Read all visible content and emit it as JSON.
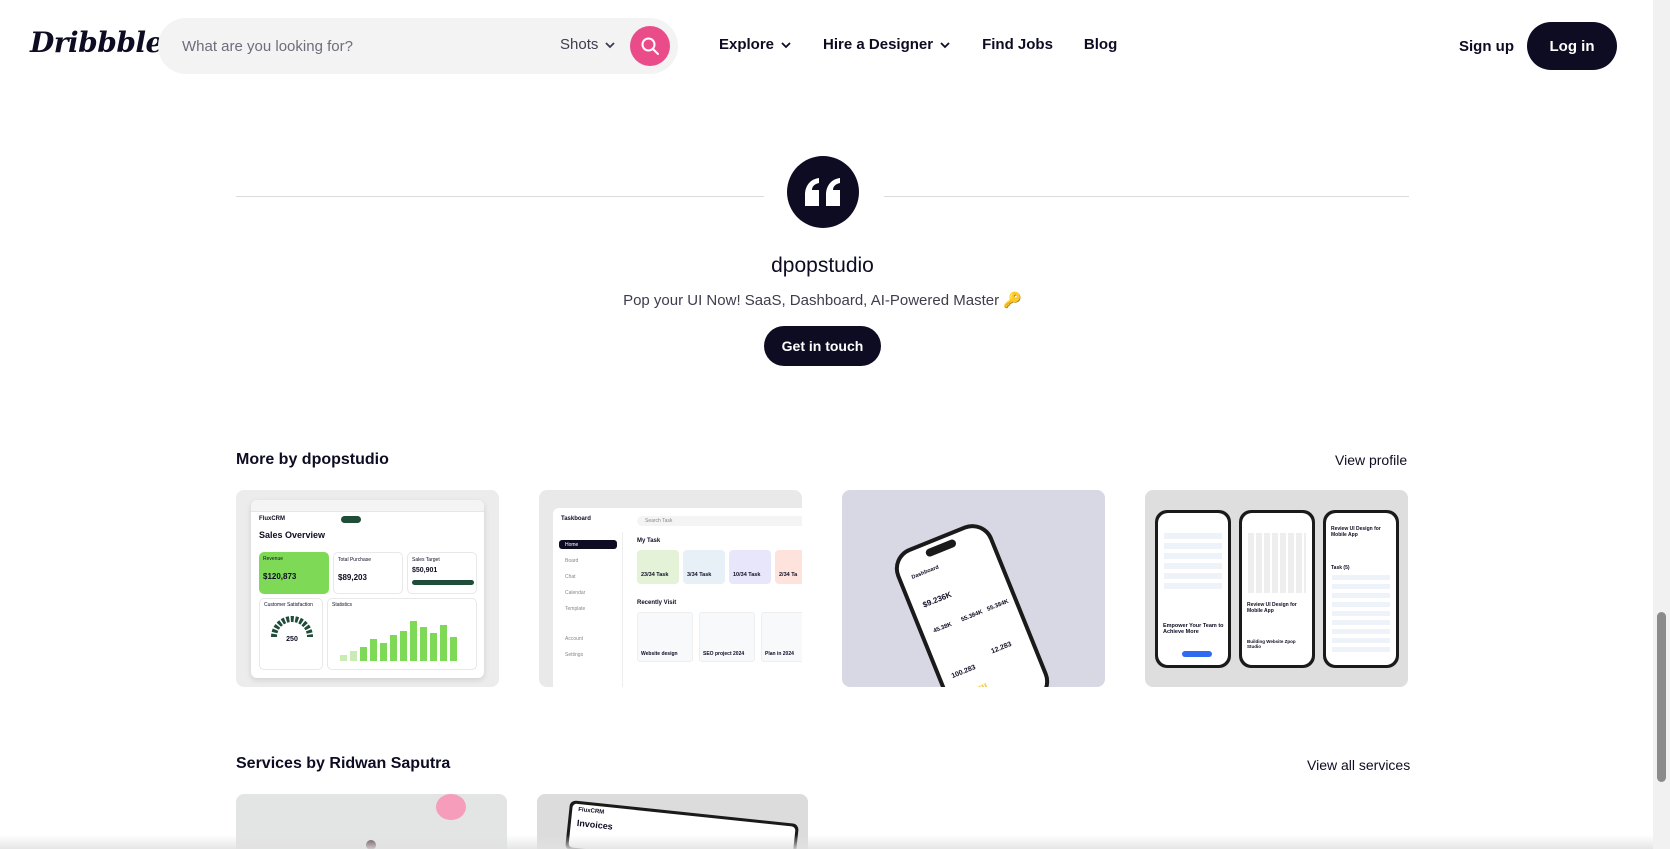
{
  "header": {
    "logo": "Dribbble",
    "search_placeholder": "What are you looking for?",
    "search_scope": "Shots",
    "nav": [
      {
        "label": "Explore",
        "has_menu": true
      },
      {
        "label": "Hire a Designer",
        "has_menu": true
      },
      {
        "label": "Find Jobs",
        "has_menu": false
      },
      {
        "label": "Blog",
        "has_menu": false
      }
    ],
    "signup": "Sign up",
    "login": "Log in"
  },
  "profile": {
    "name": "dpopstudio",
    "tagline": "Pop your UI Now! SaaS, Dashboard, AI-Powered Master 🔑",
    "cta": "Get in touch"
  },
  "more_by": {
    "title": "More by dpopstudio",
    "link": "View profile",
    "shots": [
      {
        "app": "FluxCRM",
        "heading": "Sales Overview",
        "cards": [
          {
            "label": "Revenue",
            "value": "$120,873"
          },
          {
            "label": "Total Purchase",
            "value": "$89,203"
          },
          {
            "label": "Sales Target",
            "value": "$50,901"
          }
        ],
        "gauge_label": "Customer Satisfaction",
        "gauge_value": "250",
        "stats_label": "Statistics"
      },
      {
        "app": "Taskboard",
        "search": "Search Task",
        "menu": [
          "Home",
          "Board",
          "Chat",
          "Calendar",
          "Template",
          "Account",
          "Settings"
        ],
        "section": "My Task",
        "tasks": [
          "23/34 Task",
          "3/34 Task",
          "10/34 Task",
          "2/34 Ta"
        ],
        "recent": "Recently Visit",
        "projects": [
          "Website design",
          "SEO project 2024",
          "Plan in 2024"
        ]
      },
      {
        "app": "Dashboard",
        "amount": "$9.236K",
        "stats": [
          "45.38K",
          "55.384K",
          "55.384K"
        ],
        "customer": "100.283",
        "members": "12.283"
      },
      {
        "phone_titles": [
          "Empower Your Team to Achieve More",
          "Review UI Design for Mobile App",
          "Review UI Design for Mobile App"
        ],
        "task_label": "Task (5)",
        "building": "Building Website Zpop Studio"
      }
    ]
  },
  "services": {
    "title": "Services by Ridwan Saputra",
    "link": "View all services",
    "items": [
      {
        "caption": ""
      },
      {
        "app": "FluxCRM",
        "heading": "Invoices"
      }
    ]
  },
  "colors": {
    "brand_pink": "#ea4c89",
    "ink": "#0d0c22",
    "search_bg": "#f3f3f4",
    "accent_green": "#7ed957"
  }
}
